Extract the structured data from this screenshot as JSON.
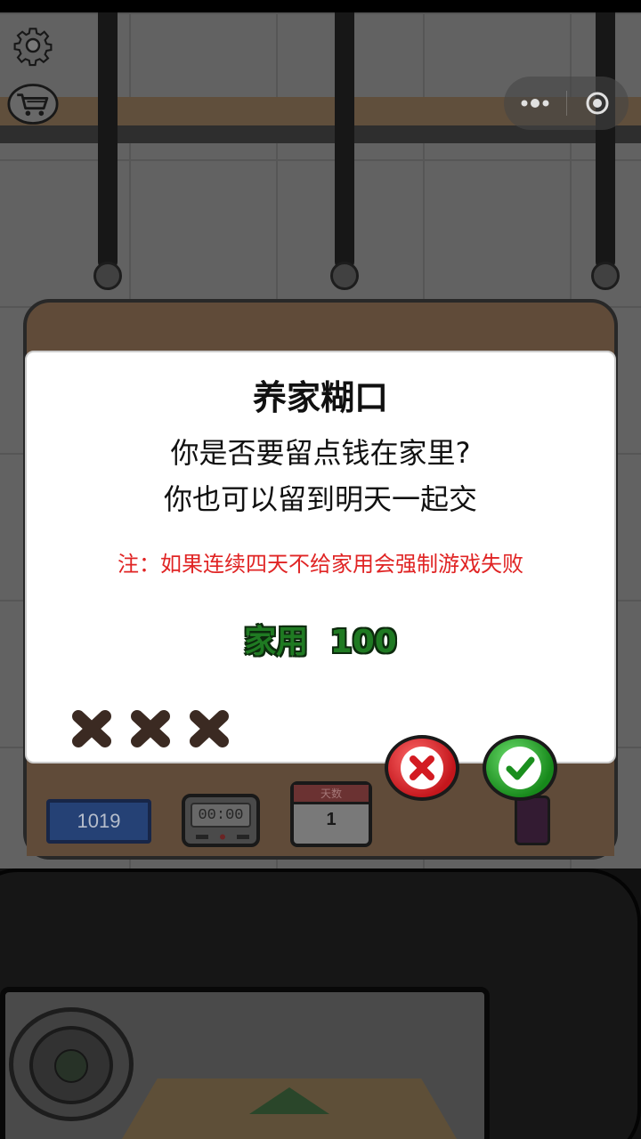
{
  "hud": {
    "settings_icon": "gear-icon",
    "shop_icon": "cart-icon",
    "capsule": {
      "more_icon": "more-dots-icon",
      "close_icon": "target-icon"
    }
  },
  "counter": {
    "money": "1019",
    "timer": "00:00",
    "calendar_label": "天数",
    "day": "1"
  },
  "dialog": {
    "title": "养家糊口",
    "line1": "你是否要留点钱在家里?",
    "line2": "你也可以留到明天一起交",
    "note": "注：如果连续四天不给家用会强制游戏失败",
    "household_label": "家用",
    "household_amount": "100",
    "missed_days": 3,
    "cancel_icon": "cross-icon",
    "confirm_icon": "check-icon"
  },
  "colors": {
    "note": "#e02424",
    "household": "#1f7a22",
    "cancel": "#c4161c",
    "confirm": "#17891b",
    "mark": "#3b2a22"
  }
}
